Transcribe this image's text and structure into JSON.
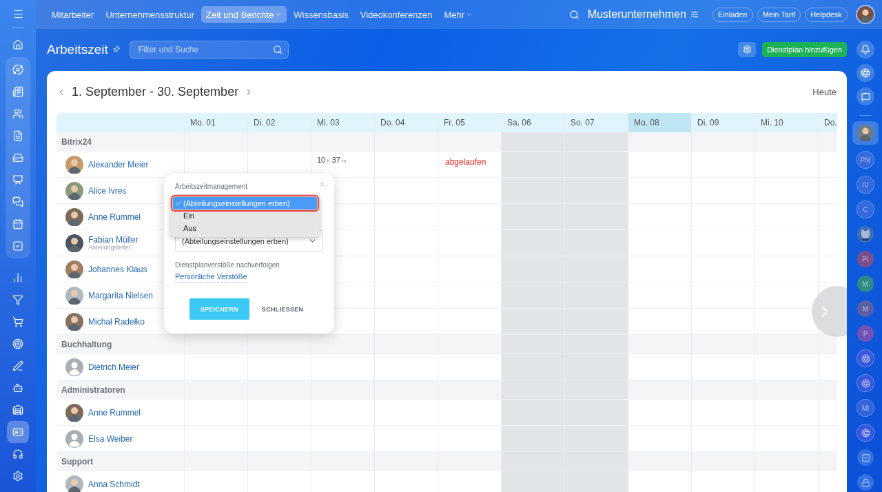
{
  "left_sidebar": {
    "items": [
      {
        "selected": false
      },
      {
        "selected": false
      },
      {
        "selected": false
      },
      {
        "selected": false
      },
      {
        "selected": false
      },
      {
        "selected": false
      },
      {
        "selected": false
      },
      {
        "selected": false
      },
      {
        "selected": false
      },
      {
        "selected": false
      },
      {
        "selected": false
      },
      {
        "selected": false
      },
      {
        "selected": false
      },
      {
        "selected": false
      },
      {
        "selected": false
      },
      {
        "selected": false
      },
      {
        "selected": false
      },
      {
        "selected": true
      },
      {
        "selected": false
      },
      {
        "selected": false
      }
    ]
  },
  "top_nav": {
    "items": [
      {
        "label": "Mitarbeiter",
        "selected": false,
        "has_menu": false
      },
      {
        "label": "Unternehmensstruktur",
        "selected": false,
        "has_menu": false
      },
      {
        "label": "Zeit und Berichte",
        "selected": true,
        "has_menu": true
      },
      {
        "label": "Wissensbasis",
        "selected": false,
        "has_menu": false
      },
      {
        "label": "Videokonferenzen",
        "selected": false,
        "has_menu": false
      },
      {
        "label": "Mehr",
        "selected": false,
        "has_menu": true
      }
    ],
    "company": "Musterunternehmen",
    "buttons": [
      "Einladen",
      "Mein Tarif",
      "Helpdesk"
    ]
  },
  "header": {
    "title": "Arbeitszeit",
    "search": {
      "placeholder": "Filter und Suche"
    },
    "add_button": "Dienstplan hinzufügen"
  },
  "calendar": {
    "range": "1. September - 30. September",
    "today_button": "Heute",
    "days": [
      {
        "label": "Mo. 01",
        "weekend": false,
        "today": false
      },
      {
        "label": "Di. 02",
        "weekend": false,
        "today": false
      },
      {
        "label": "Mi. 03",
        "weekend": false,
        "today": false
      },
      {
        "label": "Do. 04",
        "weekend": false,
        "today": false
      },
      {
        "label": "Fr. 05",
        "weekend": false,
        "today": false
      },
      {
        "label": "Sa. 06",
        "weekend": true,
        "today": false
      },
      {
        "label": "So. 07",
        "weekend": true,
        "today": false
      },
      {
        "label": "Mo. 08",
        "weekend": false,
        "today": true
      },
      {
        "label": "Di. 09",
        "weekend": false,
        "today": false
      },
      {
        "label": "Mi. 10",
        "weekend": false,
        "today": false
      },
      {
        "label": "Do.",
        "weekend": false,
        "today": false
      }
    ],
    "rows": [
      {
        "kind": "group",
        "name": "Bitrix24"
      },
      {
        "kind": "person",
        "name": "Alexander Meier",
        "cells": [
          {
            "kind": "empty"
          },
          {
            "kind": "empty"
          },
          {
            "kind": "duration",
            "hours": "10",
            "h": "h",
            "minutes": "37",
            "m": "m"
          },
          {
            "kind": "empty"
          },
          {
            "kind": "expired",
            "text": "abgelaufen"
          }
        ]
      },
      {
        "kind": "person",
        "name": "Alice Ivres"
      },
      {
        "kind": "person",
        "name": "Anne Rummel"
      },
      {
        "kind": "person",
        "name": "Fabian Müller",
        "role": "Abteilungsleiter"
      },
      {
        "kind": "person",
        "name": "Johannes Klaus"
      },
      {
        "kind": "person",
        "name": "Margarita Nielsen"
      },
      {
        "kind": "person",
        "name": "Michał Radełko"
      },
      {
        "kind": "group",
        "name": "Buchhaltung"
      },
      {
        "kind": "anonymous",
        "name": "Dietrich Meier"
      },
      {
        "kind": "group",
        "name": "Administratoren"
      },
      {
        "kind": "person",
        "name": "Anne Rummel"
      },
      {
        "kind": "anonymous",
        "name": "Elsa Weiber"
      },
      {
        "kind": "group",
        "name": "Support"
      },
      {
        "kind": "person",
        "name": "Anna Schmidt"
      }
    ]
  },
  "popup": {
    "label": "Arbeitszeitmanagement",
    "options": [
      {
        "label": "(Abteilungseinstellungen erben)",
        "selected": true
      },
      {
        "label": "Ein",
        "selected": false
      },
      {
        "label": "Aus",
        "selected": false
      }
    ],
    "second_select": {
      "value": "(Abteilungseinstellungen erben)"
    },
    "violations_label": "Dienstplanverstöße nachverfolgen",
    "violations_link": "Persönliche Verstöße",
    "save": "SPEICHERN",
    "close": "SCHLIESSEN"
  },
  "right_sidebar": {
    "contacts": [
      {
        "kind": "photo",
        "selected": true
      },
      {
        "kind": "initials",
        "initials": "PM",
        "selected": false
      },
      {
        "kind": "initials",
        "initials": "IV",
        "selected": false
      },
      {
        "kind": "initials",
        "initials": "C",
        "selected": false
      },
      {
        "kind": "cat",
        "selected": false
      },
      {
        "kind": "filled",
        "initials": "PI",
        "color": "#7a4f8e",
        "selected": false
      },
      {
        "kind": "filled",
        "initials": "M",
        "color": "#2e8a86",
        "selected": false
      },
      {
        "kind": "filled",
        "initials": "M",
        "color": "#5a5fa6",
        "selected": false
      },
      {
        "kind": "filled",
        "initials": "P",
        "color": "#7352b8",
        "selected": false
      },
      {
        "kind": "spiral",
        "selected": false
      },
      {
        "kind": "spiral",
        "selected": false
      },
      {
        "kind": "initials",
        "initials": "MI",
        "selected": false
      },
      {
        "kind": "spiral",
        "selected": false
      },
      {
        "kind": "tasks",
        "selected": false
      },
      {
        "kind": "lock",
        "selected": false
      }
    ]
  }
}
